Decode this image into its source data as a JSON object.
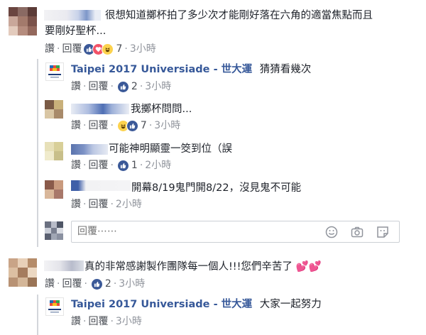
{
  "colors": {
    "link_blue": "#365899",
    "meta_gray": "#90949c",
    "action_gray": "#4b4f56",
    "thread_line": "#d3d6db",
    "like_blue": "#3b5998",
    "love_red": "#f25268"
  },
  "comments": [
    {
      "text_line1": "很想知道擲杯拍了多少次才能剛好落在六角的適當焦點而且",
      "text_line2": "要剛好聖杯...",
      "actions": {
        "like": "讚",
        "reply": "回覆",
        "count": "7",
        "time": "3小時"
      },
      "reactions": [
        "like-icon",
        "love-icon",
        "haha-icon"
      ],
      "replies": [
        {
          "author": "Taipei 2017 Universiade - 世大運",
          "text": "猜猜看幾次",
          "actions": {
            "like": "讚",
            "reply": "回覆",
            "count": "2",
            "time": "3小時"
          },
          "reactions": [
            "like-icon"
          ]
        },
        {
          "text": "我擲杯問問...",
          "actions": {
            "like": "讚",
            "reply": "回覆",
            "count": "7",
            "time": "3小時"
          },
          "reactions": [
            "haha-icon",
            "like-icon"
          ]
        },
        {
          "text": "可能神明顯靈一筊到位（誤",
          "actions": {
            "like": "讚",
            "reply": "回覆",
            "count": "1",
            "time": "2小時"
          },
          "reactions": [
            "like-icon"
          ]
        },
        {
          "text": "開幕8/19鬼門開8/22，沒見鬼不可能",
          "actions": {
            "like": "讚",
            "reply": "回覆",
            "time": "2小時"
          }
        }
      ],
      "reply_box": {
        "placeholder": "回覆⋯⋯",
        "icons": [
          "emoji-icon",
          "camera-icon",
          "sticker-icon"
        ]
      }
    },
    {
      "text": "真的非常感謝製作團隊每一個人!!!您們辛苦了",
      "emoji": "💕💕",
      "actions": {
        "like": "讚",
        "reply": "回覆",
        "count": "2",
        "time": "3小時"
      },
      "reactions": [
        "like-icon"
      ],
      "replies": [
        {
          "author": "Taipei 2017 Universiade - 世大運",
          "text": "大家一起努力",
          "actions": {
            "like": "讚",
            "reply": "回覆",
            "time": "3小時"
          }
        }
      ]
    }
  ]
}
